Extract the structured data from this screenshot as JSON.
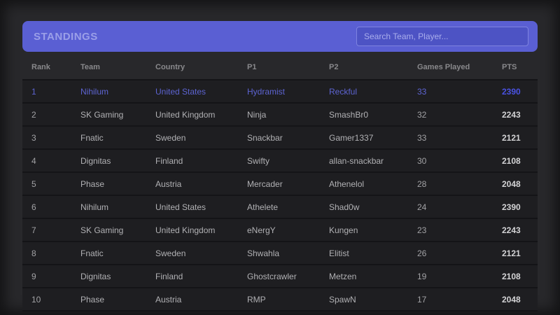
{
  "header": {
    "title": "STANDINGS",
    "search_placeholder": "Search Team, Player..."
  },
  "table": {
    "columns": [
      "Rank",
      "Team",
      "Country",
      "P1",
      "P2",
      "Games Played",
      "PTS"
    ],
    "rows": [
      {
        "rank": "1",
        "team": "Nihilum",
        "country": "United States",
        "p1": "Hydramist",
        "p2": "Reckful",
        "games_played": "33",
        "pts": "2390",
        "highlighted": true
      },
      {
        "rank": "2",
        "team": "SK Gaming",
        "country": "United Kingdom",
        "p1": "Ninja",
        "p2": "SmashBr0",
        "games_played": "32",
        "pts": "2243",
        "highlighted": false
      },
      {
        "rank": "3",
        "team": "Fnatic",
        "country": "Sweden",
        "p1": "Snackbar",
        "p2": "Gamer1337",
        "games_played": "33",
        "pts": "2121",
        "highlighted": false
      },
      {
        "rank": "4",
        "team": "Dignitas",
        "country": "Finland",
        "p1": "Swifty",
        "p2": "allan-snackbar",
        "games_played": "30",
        "pts": "2108",
        "highlighted": false
      },
      {
        "rank": "5",
        "team": "Phase",
        "country": "Austria",
        "p1": "Mercader",
        "p2": "Athenelol",
        "games_played": "28",
        "pts": "2048",
        "highlighted": false
      },
      {
        "rank": "6",
        "team": "Nihilum",
        "country": "United States",
        "p1": "Athelete",
        "p2": "Shad0w",
        "games_played": "24",
        "pts": "2390",
        "highlighted": false
      },
      {
        "rank": "7",
        "team": "SK Gaming",
        "country": "United Kingdom",
        "p1": "eNergY",
        "p2": "Kungen",
        "games_played": "23",
        "pts": "2243",
        "highlighted": false
      },
      {
        "rank": "8",
        "team": "Fnatic",
        "country": "Sweden",
        "p1": "Shwahla",
        "p2": "Elitist",
        "games_played": "26",
        "pts": "2121",
        "highlighted": false
      },
      {
        "rank": "9",
        "team": "Dignitas",
        "country": "Finland",
        "p1": "Ghostcrawler",
        "p2": "Metzen",
        "games_played": "19",
        "pts": "2108",
        "highlighted": false
      },
      {
        "rank": "10",
        "team": "Phase",
        "country": "Austria",
        "p1": "RMP",
        "p2": "SpawN",
        "games_played": "17",
        "pts": "2048",
        "highlighted": false
      }
    ]
  },
  "colors": {
    "accent": "#5a5fd3",
    "page_background": "#28282b",
    "row_background": "#1e1e21",
    "highlight_text": "#5d64d2",
    "highlight_pts": "#4a52e2",
    "title_text": "#9b9fe8"
  }
}
